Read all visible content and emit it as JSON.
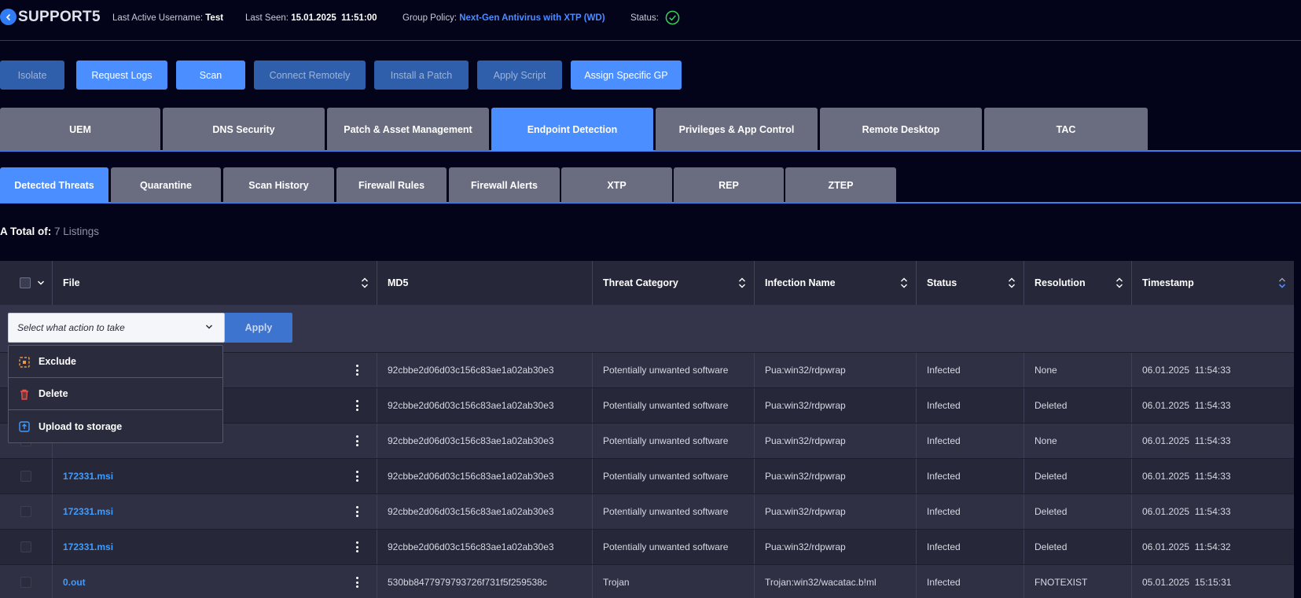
{
  "header": {
    "host": "SUPPORT5",
    "last_active_label": "Last Active Username:",
    "last_active_value": "Test",
    "last_seen_label": "Last Seen:",
    "last_seen_value": "15.01.2025  11:51:00",
    "group_policy_label": "Group Policy:",
    "group_policy_value": "Next-Gen Antivirus with XTP (WD)",
    "status_label": "Status:"
  },
  "actions": [
    "Isolate",
    "Request Logs",
    "Scan",
    "Connect Remotely",
    "Install a Patch",
    "Apply Script",
    "Assign Specific GP"
  ],
  "tabs": [
    "UEM",
    "DNS Security",
    "Patch & Asset Management",
    "Endpoint Detection",
    "Privileges & App Control",
    "Remote Desktop",
    "TAC"
  ],
  "active_tab": "Endpoint Detection",
  "subtabs": [
    "Detected Threats",
    "Quarantine",
    "Scan History",
    "Firewall Rules",
    "Firewall Alerts",
    "XTP",
    "REP",
    "ZTEP"
  ],
  "active_subtab": "Detected Threats",
  "total": {
    "label": "A Total of:",
    "count": "7 Listings"
  },
  "table": {
    "columns": [
      "File",
      "MD5",
      "Threat Category",
      "Infection Name",
      "Status",
      "Resolution",
      "Timestamp"
    ],
    "action_select_placeholder": "Select what action to take",
    "apply_label": "Apply",
    "rows": [
      {
        "file": "",
        "md5": "92cbbe2d06d03c156c83ae1a02ab30e3",
        "category": "Potentially unwanted software",
        "infection": "Pua:win32/rdpwrap",
        "status": "Infected",
        "resolution": "None",
        "timestamp": "06.01.2025  11:54:33"
      },
      {
        "file": "",
        "md5": "92cbbe2d06d03c156c83ae1a02ab30e3",
        "category": "Potentially unwanted software",
        "infection": "Pua:win32/rdpwrap",
        "status": "Infected",
        "resolution": "Deleted",
        "timestamp": "06.01.2025  11:54:33"
      },
      {
        "file": "",
        "md5": "92cbbe2d06d03c156c83ae1a02ab30e3",
        "category": "Potentially unwanted software",
        "infection": "Pua:win32/rdpwrap",
        "status": "Infected",
        "resolution": "None",
        "timestamp": "06.01.2025  11:54:33"
      },
      {
        "file": "172331.msi",
        "md5": "92cbbe2d06d03c156c83ae1a02ab30e3",
        "category": "Potentially unwanted software",
        "infection": "Pua:win32/rdpwrap",
        "status": "Infected",
        "resolution": "Deleted",
        "timestamp": "06.01.2025  11:54:33"
      },
      {
        "file": "172331.msi",
        "md5": "92cbbe2d06d03c156c83ae1a02ab30e3",
        "category": "Potentially unwanted software",
        "infection": "Pua:win32/rdpwrap",
        "status": "Infected",
        "resolution": "Deleted",
        "timestamp": "06.01.2025  11:54:33"
      },
      {
        "file": "172331.msi",
        "md5": "92cbbe2d06d03c156c83ae1a02ab30e3",
        "category": "Potentially unwanted software",
        "infection": "Pua:win32/rdpwrap",
        "status": "Infected",
        "resolution": "Deleted",
        "timestamp": "06.01.2025  11:54:32"
      },
      {
        "file": "0.out",
        "md5": "530bb8477979793726f731f5f259538c",
        "category": "Trojan",
        "infection": "Trojan:win32/wacatac.b!ml",
        "status": "Infected",
        "resolution": "FNOTEXIST",
        "timestamp": "05.01.2025  15:15:31"
      }
    ]
  },
  "menu": {
    "items": [
      {
        "label": "Exclude",
        "icon": "exclude-icon"
      },
      {
        "label": "Delete",
        "icon": "trash-icon"
      },
      {
        "label": "Upload to storage",
        "icon": "upload-icon"
      }
    ]
  },
  "colors": {
    "accent": "#4b8eff",
    "background": "#03041a",
    "link": "#3f9cff",
    "status_ok": "#3dcc5a"
  }
}
